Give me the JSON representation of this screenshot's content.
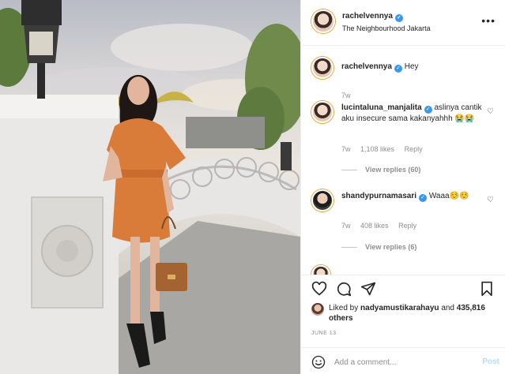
{
  "post": {
    "author": "rachelvennya",
    "location": "The Neighbourhood Jakarta",
    "more_icon": "more-icon"
  },
  "caption": {
    "username": "rachelvennya",
    "text": "Hey",
    "time": "7w"
  },
  "comments": [
    {
      "username": "lucintaluna_manjalita",
      "text": "aslinya cantik aku insecure sama kakanyahhh 😭😭",
      "time": "7w",
      "likes": "1,108 likes",
      "reply": "Reply",
      "view_replies": "View replies (60)"
    },
    {
      "username": "shandypurnamasari",
      "text": "Waaa☺️☺️",
      "time": "7w",
      "likes": "408 likes",
      "reply": "Reply",
      "view_replies": "View replies (6)"
    }
  ],
  "liked_by": {
    "prefix": "Liked by",
    "user": "nadyamustikarahayu",
    "and": "and",
    "others": "435,816 others"
  },
  "date": "JUNE 13",
  "add_comment": {
    "placeholder": "Add a comment...",
    "post_label": "Post"
  },
  "colors": {
    "verified": "#3897f0",
    "text": "#262626",
    "muted": "#8e8e8e",
    "post_disabled": "#b2dffc"
  }
}
